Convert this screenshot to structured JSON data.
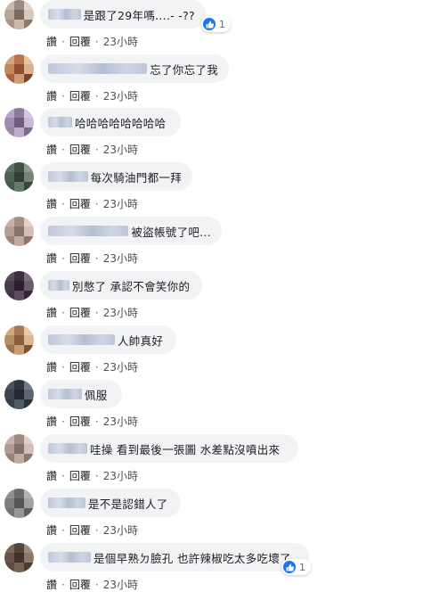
{
  "comments": [
    {
      "text": "是跟了29年嗎....- -??",
      "reactions": "1",
      "avatar": [
        "#c9b9ad",
        "#9d8b7f",
        "#e2d6cc",
        "#b7a69a",
        "#7c6a60",
        "#d8c8bc",
        "#a89588",
        "#cbb8aa",
        "#8d7a6e"
      ]
    },
    {
      "text": "忘了你忘了我",
      "reactions": null,
      "avatar": [
        "#d9a27a",
        "#b8734f",
        "#e8c3a1",
        "#c1875d",
        "#8e4f33",
        "#ddb08c",
        "#a76547",
        "#cf9a74",
        "#7a4430"
      ]
    },
    {
      "text": "哈哈哈哈哈哈哈哈",
      "reactions": null,
      "avatar": [
        "#b9a6c4",
        "#8f7a9f",
        "#d6c7de",
        "#a08db2",
        "#6f5b80",
        "#cbb9d4",
        "#9a86aa",
        "#bfaccc",
        "#7d6a8e"
      ]
    },
    {
      "text": "每次騎油門都一拜",
      "reactions": null,
      "avatar": [
        "#5f7263",
        "#3f5245",
        "#8a9a8c",
        "#4e6253",
        "#2f3f33",
        "#738676",
        "#465a4b",
        "#667a69",
        "#35463a"
      ]
    },
    {
      "text": "被盜帳號了吧...",
      "reactions": null,
      "avatar": [
        "#c9b3a6",
        "#a48d81",
        "#e0d0c6",
        "#b59e92",
        "#87716a",
        "#d3bfb4",
        "#9c857a",
        "#c2ab9e",
        "#8b766c"
      ]
    },
    {
      "text": "別憋了 承認不會笑你的",
      "reactions": null,
      "avatar": [
        "#5b4a5e",
        "#3b2c3e",
        "#7e6b80",
        "#4a3a4d",
        "#2a1f2c",
        "#6b5a6e",
        "#43344a",
        "#5e4c62",
        "#33263a"
      ]
    },
    {
      "text": "人帥真好",
      "reactions": null,
      "avatar": [
        "#d2a87e",
        "#a77a55",
        "#e6c9a8",
        "#b98c63",
        "#8a5d3b",
        "#dbb792",
        "#a07150",
        "#c99c72",
        "#7f5435"
      ]
    },
    {
      "text": "佩服",
      "reactions": null,
      "avatar": [
        "#4a5360",
        "#2e3540",
        "#707a88",
        "#3c4450",
        "#232932",
        "#5c6573",
        "#353d48",
        "#4f5866",
        "#2a313b"
      ]
    },
    {
      "text": "哇操 看到最後一張圖 水差點沒噴出來",
      "reactions": null,
      "avatar": [
        "#c6b3ab",
        "#9f8a82",
        "#ddcfc9",
        "#b09c93",
        "#80706a",
        "#d1bfb8",
        "#988379",
        "#c0aca3",
        "#8a766d"
      ]
    },
    {
      "text": "是不是認錯人了",
      "reactions": null,
      "avatar": [
        "#8f8f8f",
        "#6a6a6a",
        "#b3b3b3",
        "#7d7d7d",
        "#555555",
        "#a2a2a2",
        "#737373",
        "#969696",
        "#5f5f5f"
      ]
    },
    {
      "text": "是個早熟ㄉ臉孔 也許辣椒吃太多吃壞了",
      "reactions": "1",
      "avatar": [
        "#7b6757",
        "#55443a",
        "#a08c7c",
        "#66544a",
        "#40332b",
        "#8c786a",
        "#5c4b40",
        "#766252",
        "#4a3b32"
      ]
    }
  ],
  "actions": {
    "read": "讚",
    "reply": "回覆",
    "time": "23小時",
    "separator": "·"
  }
}
